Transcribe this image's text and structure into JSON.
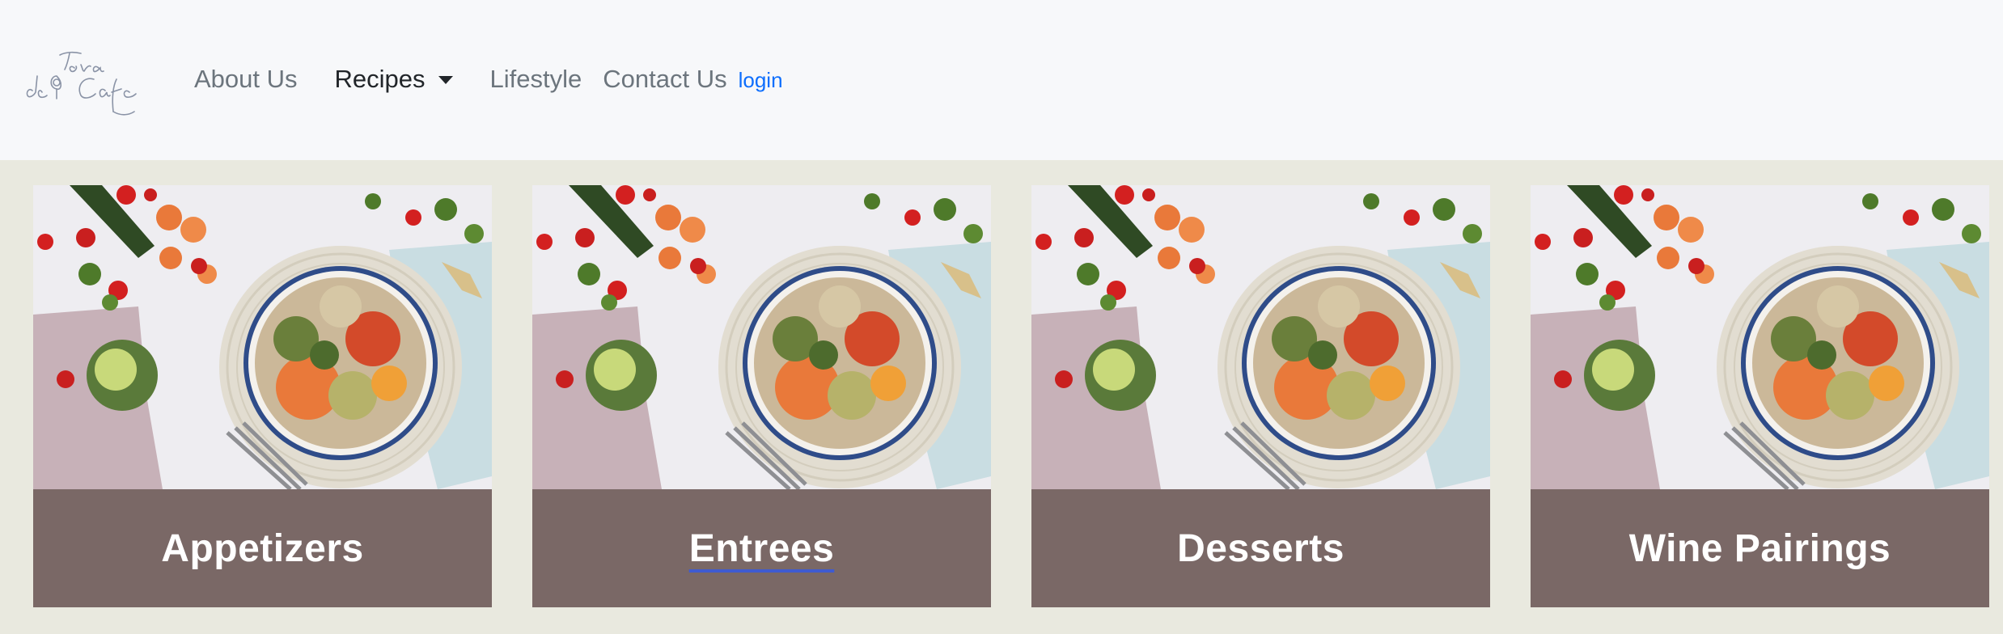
{
  "navbar": {
    "brand_logo": "Tera de Cafe",
    "links": [
      {
        "label": "About Us"
      },
      {
        "label": "Recipes"
      },
      {
        "label": "Lifestyle"
      },
      {
        "label": "Contact Us"
      }
    ],
    "login_label": "login",
    "login_color": "#0d6efd"
  },
  "cards": [
    {
      "title": "Appetizers",
      "image": "salad-bowl-photo"
    },
    {
      "title": "Entrees",
      "image": "salad-bowl-photo"
    },
    {
      "title": "Desserts",
      "image": "salad-bowl-photo"
    },
    {
      "title": "Wine Pairings",
      "image": "salad-bowl-photo"
    }
  ],
  "colors": {
    "page_background": "#e9e9df",
    "navbar_background": "#f7f8fa",
    "card_footer": "#7a6866"
  }
}
